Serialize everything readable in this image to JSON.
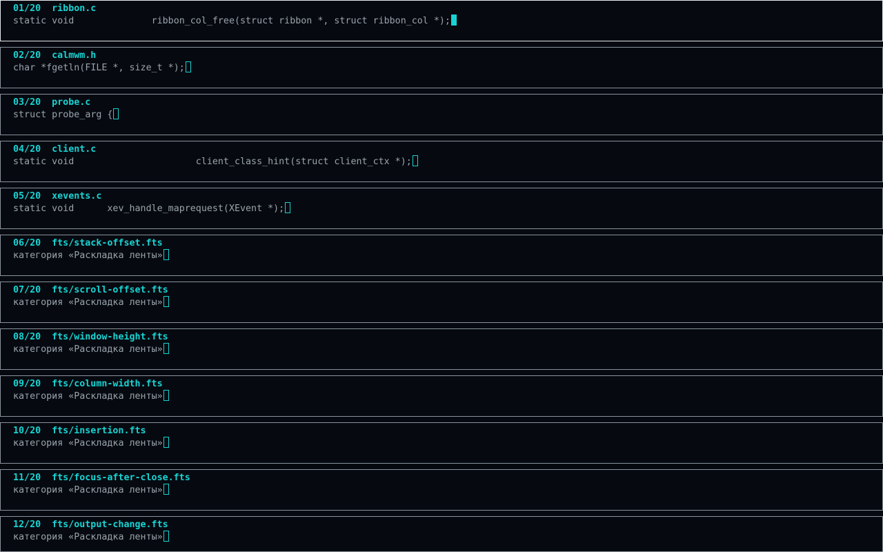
{
  "colors": {
    "background": "#060a10",
    "accent": "#19d3d3",
    "text": "#9aa3ab",
    "border": "#8a929c",
    "focused_border": "#e6eaee"
  },
  "panes": [
    {
      "index": "01/20",
      "name": "ribbon.c",
      "line": "static void              ribbon_col_free(struct ribbon *, struct ribbon_col *);",
      "focused": true
    },
    {
      "index": "02/20",
      "name": "calmwm.h",
      "line": "char *fgetln(FILE *, size_t *);",
      "focused": false
    },
    {
      "index": "03/20",
      "name": "probe.c",
      "line": "struct probe_arg {",
      "focused": false
    },
    {
      "index": "04/20",
      "name": "client.c",
      "line": "static void                      client_class_hint(struct client_ctx *);",
      "focused": false
    },
    {
      "index": "05/20",
      "name": "xevents.c",
      "line": "static void      xev_handle_maprequest(XEvent *);",
      "focused": false
    },
    {
      "index": "06/20",
      "name": "fts/stack-offset.fts",
      "line": "категория «Раскладка ленты»",
      "focused": false
    },
    {
      "index": "07/20",
      "name": "fts/scroll-offset.fts",
      "line": "категория «Раскладка ленты»",
      "focused": false
    },
    {
      "index": "08/20",
      "name": "fts/window-height.fts",
      "line": "категория «Раскладка ленты»",
      "focused": false
    },
    {
      "index": "09/20",
      "name": "fts/column-width.fts",
      "line": "категория «Раскладка ленты»",
      "focused": false
    },
    {
      "index": "10/20",
      "name": "fts/insertion.fts",
      "line": "категория «Раскладка ленты»",
      "focused": false
    },
    {
      "index": "11/20",
      "name": "fts/focus-after-close.fts",
      "line": "категория «Раскладка ленты»",
      "focused": false
    },
    {
      "index": "12/20",
      "name": "fts/output-change.fts",
      "line": "категория «Раскладка ленты»",
      "focused": false
    }
  ]
}
